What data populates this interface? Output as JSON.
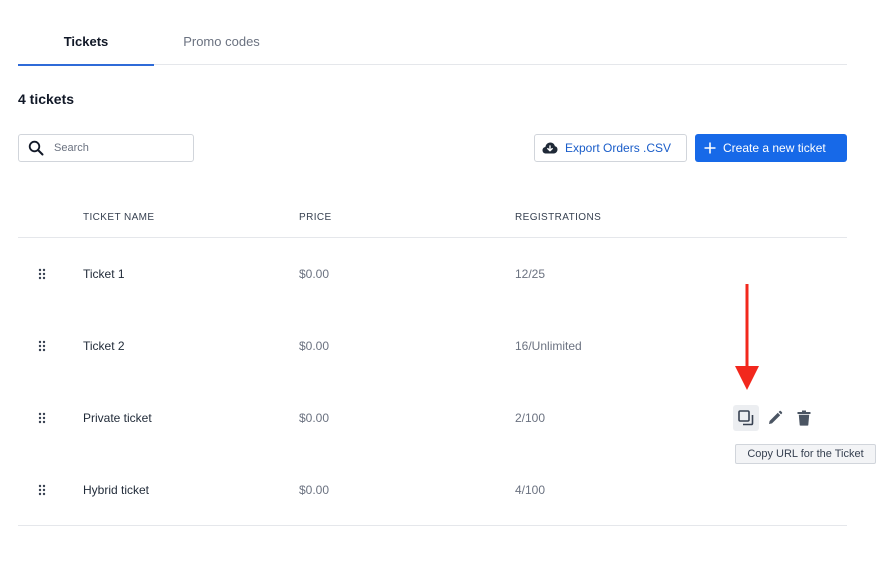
{
  "tabs": [
    {
      "label": "Tickets",
      "active": true
    },
    {
      "label": "Promo codes",
      "active": false
    }
  ],
  "summary": {
    "count_label": "4 tickets"
  },
  "search": {
    "placeholder": "Search",
    "value": ""
  },
  "toolbar": {
    "export_label": "Export Orders .CSV",
    "create_label": "Create a new ticket"
  },
  "table": {
    "columns": [
      "TICKET NAME",
      "PRICE",
      "REGISTRATIONS"
    ],
    "rows": [
      {
        "name": "Ticket 1",
        "price": "$0.00",
        "registrations": "12/25"
      },
      {
        "name": "Ticket 2",
        "price": "$0.00",
        "registrations": "16/Unlimited"
      },
      {
        "name": "Private ticket",
        "price": "$0.00",
        "registrations": "2/100"
      },
      {
        "name": "Hybrid ticket",
        "price": "$0.00",
        "registrations": "4/100"
      }
    ]
  },
  "row_actions": {
    "icons": [
      "copy-url-icon",
      "pencil-icon",
      "trash-icon"
    ],
    "tooltip": "Copy URL for the Ticket"
  },
  "colors": {
    "accent": "#1769e8",
    "active_tab_underline": "#2f6bd8",
    "annotation_arrow": "#f2281d"
  }
}
